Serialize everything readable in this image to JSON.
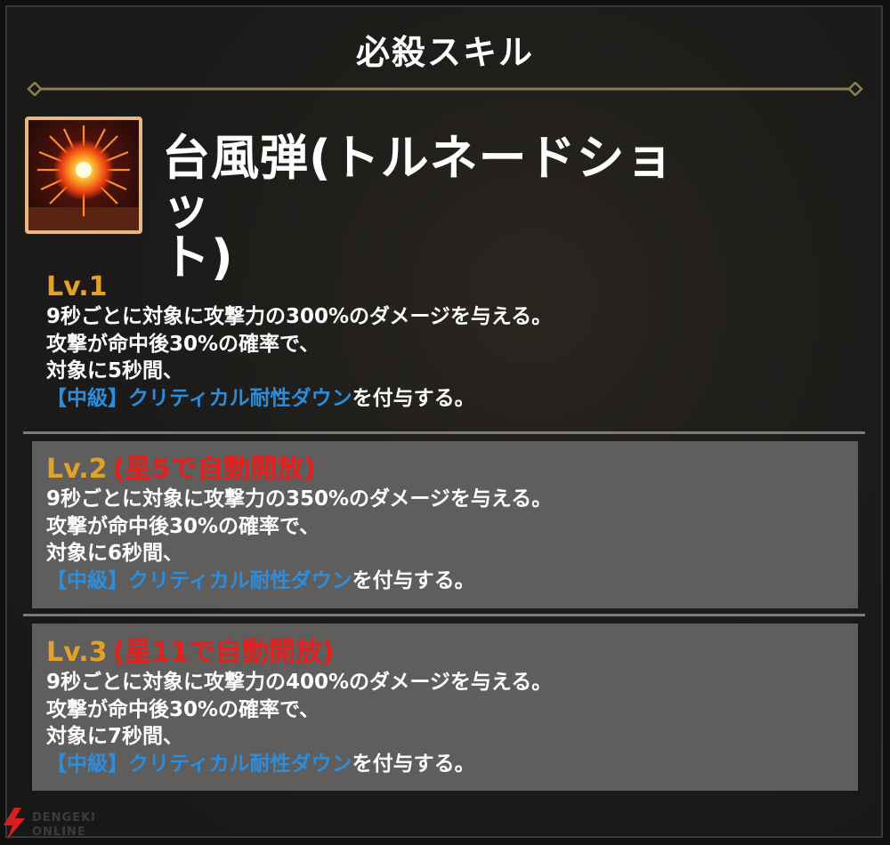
{
  "header": {
    "title": "必殺スキル"
  },
  "skill": {
    "name_line1": "台風弾(トルネードショッ",
    "name_line2": "ト)",
    "icon": "explosion-icon"
  },
  "levels": [
    {
      "level": "Lv.1",
      "unlock": "",
      "lines": [
        "9秒ごとに対象に攻撃力の300%のダメージを与える。",
        "攻撃が命中後30%の確率で、",
        "対象に5秒間、"
      ],
      "effect": "【中級】クリティカル耐性ダウン",
      "effect_suffix": "を付与する。"
    },
    {
      "level": "Lv.2",
      "unlock": "(星5で自動開放)",
      "lines": [
        "9秒ごとに対象に攻撃力の350%のダメージを与える。",
        "攻撃が命中後30%の確率で、",
        "対象に6秒間、"
      ],
      "effect": "【中級】クリティカル耐性ダウン",
      "effect_suffix": "を付与する。"
    },
    {
      "level": "Lv.3",
      "unlock": "(星11で自動開放)",
      "lines": [
        "9秒ごとに対象に攻撃力の400%のダメージを与える。",
        "攻撃が命中後30%の確率で、",
        "対象に7秒間、"
      ],
      "effect": "【中級】クリティカル耐性ダウン",
      "effect_suffix": "を付与する。"
    }
  ],
  "watermark": {
    "line1": "DENGEKI",
    "line2": "ONLINE"
  },
  "colors": {
    "level": "#e2a22a",
    "unlock": "#e3201e",
    "effect": "#2a8dde",
    "box": "#5f5e5c"
  }
}
